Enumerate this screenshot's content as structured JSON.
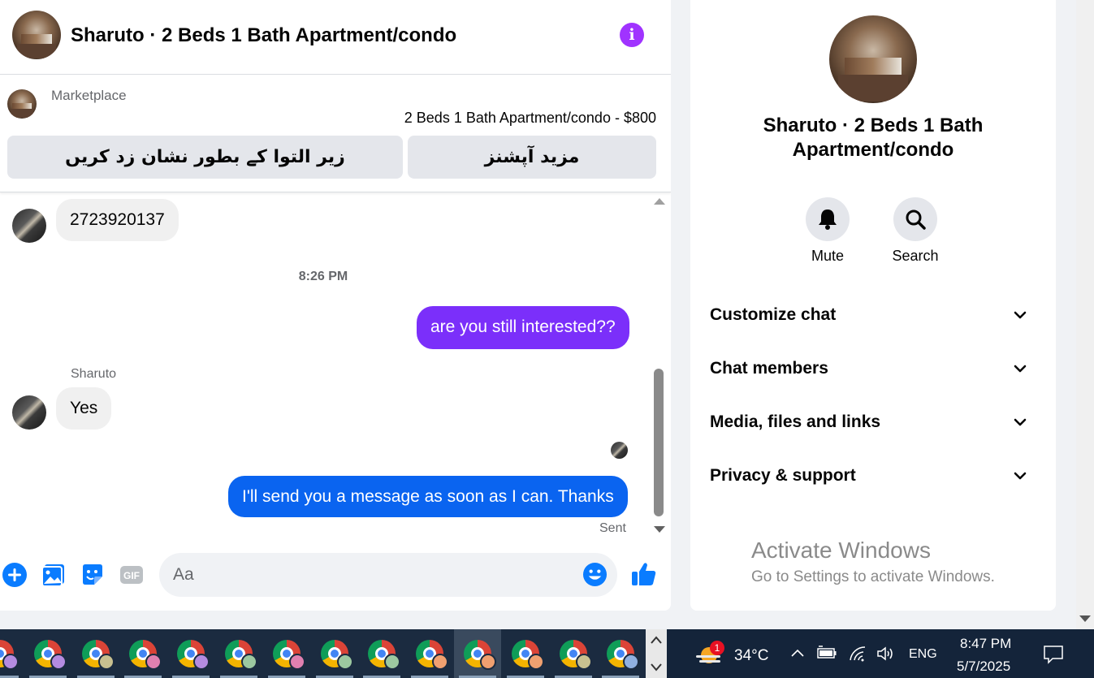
{
  "header": {
    "title": "Sharuto · 2 Beds 1 Bath Apartment/condo"
  },
  "marketplace": {
    "label": "Marketplace",
    "listing": "2 Beds 1 Bath Apartment/condo - $800",
    "mark_pending_label": "زیر التوا کے بطور نشان زد کریں",
    "more_options_label": "مزید آپشنز"
  },
  "messages": {
    "m1": "2723920137",
    "timestamp": "8:26 PM",
    "m2": "are you still interested??",
    "sender": "Sharuto",
    "m3": "Yes",
    "m4": "I'll send you a message as soon as I can. Thanks",
    "status": "Sent"
  },
  "composer": {
    "placeholder": "Aa"
  },
  "details": {
    "title_line1": "Sharuto · 2 Beds 1 Bath",
    "title_line2": "Apartment/condo",
    "mute_label": "Mute",
    "search_label": "Search",
    "sections": [
      "Customize chat",
      "Chat members",
      "Media, files and links",
      "Privacy & support"
    ]
  },
  "watermark": {
    "line1": "Activate Windows",
    "line2": "Go to Settings to activate Windows."
  },
  "taskbar": {
    "weather_badge": "1",
    "temperature": "34°C",
    "language": "ENG",
    "time": "8:47 PM",
    "date": "5/7/2025",
    "profile_colors": [
      "#b48be0",
      "#b48be0",
      "#c8c090",
      "#e080b0",
      "#b48be0",
      "#9cc8a0",
      "#e080b0",
      "#9cc8a0",
      "#9cc8a0",
      "#f0a070",
      "#f0a070",
      "#f0a070",
      "#c8c090",
      "#90b0e0"
    ]
  },
  "colors": {
    "messenger_purple": "#a033ff",
    "bubble_purple": "#7b2ffa",
    "bubble_blue": "#0a64f0",
    "action_blue": "#0a7cff"
  }
}
